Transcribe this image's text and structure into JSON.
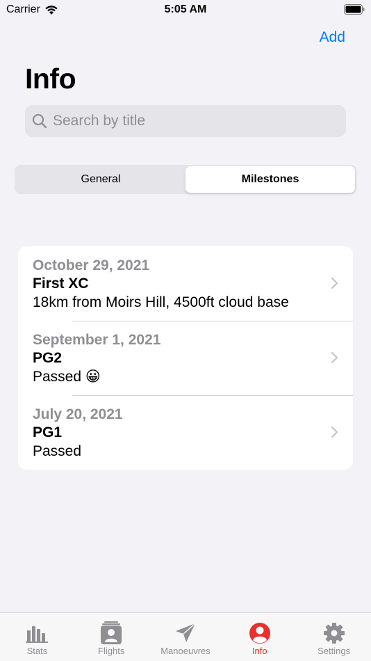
{
  "status_bar": {
    "carrier": "Carrier",
    "time": "5:05 AM"
  },
  "header": {
    "add_label": "Add",
    "title": "Info"
  },
  "search": {
    "placeholder": "Search by title",
    "value": ""
  },
  "segments": [
    {
      "label": "General",
      "active": false
    },
    {
      "label": "Milestones",
      "active": true
    }
  ],
  "milestones": [
    {
      "date": "October 29, 2021",
      "title": "First XC",
      "subtitle": "18km from Moirs Hill, 4500ft cloud base"
    },
    {
      "date": "September 1, 2021",
      "title": "PG2",
      "subtitle": "Passed 😀"
    },
    {
      "date": "July 20, 2021",
      "title": "PG1",
      "subtitle": "Passed"
    }
  ],
  "tabs": [
    {
      "label": "Stats",
      "icon": "bar-chart-icon",
      "active": false
    },
    {
      "label": "Flights",
      "icon": "logbook-icon",
      "active": false
    },
    {
      "label": "Manoeuvres",
      "icon": "paper-plane-icon",
      "active": false
    },
    {
      "label": "Info",
      "icon": "person-icon",
      "active": true
    },
    {
      "label": "Settings",
      "icon": "gear-icon",
      "active": false
    }
  ],
  "colors": {
    "accent": "#007aff",
    "active_tab": "#e8302c",
    "inactive_tab": "#8e8e93",
    "background": "#f2f2f7"
  }
}
